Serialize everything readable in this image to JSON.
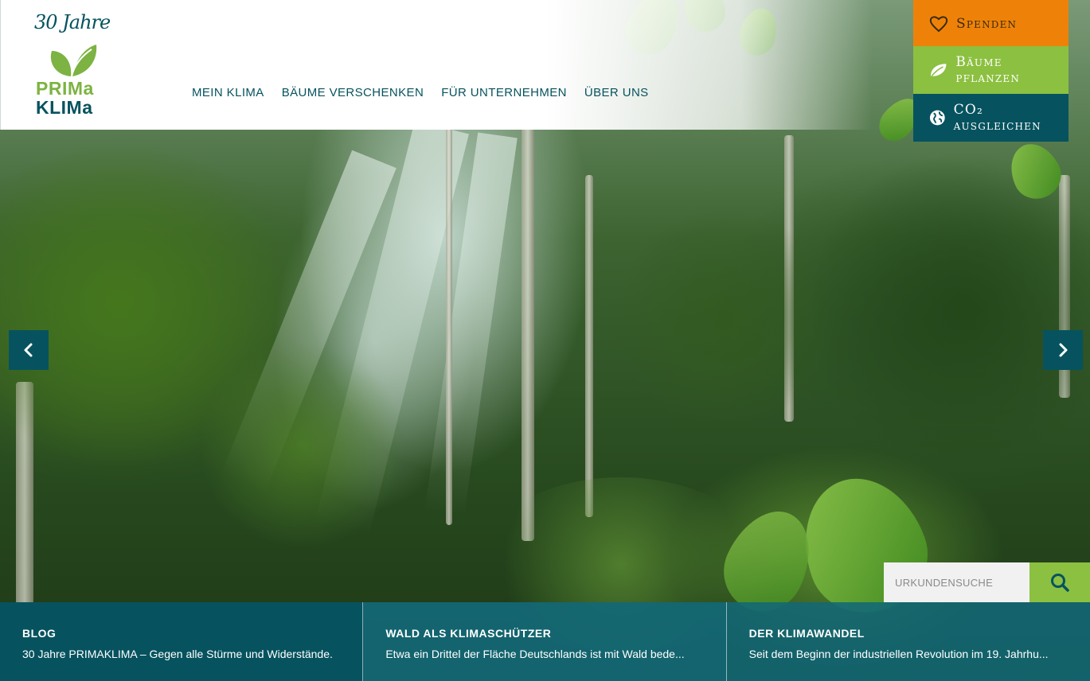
{
  "brand": {
    "anniversary": "30 Jahre",
    "wordmark_line1": "PRIMa",
    "wordmark_line2": "KLIMa",
    "colors": {
      "teal": "#06535f",
      "green": "#8cc040",
      "orange": "#ee8208"
    }
  },
  "nav": {
    "items": [
      {
        "label": "MEIN KLIMA"
      },
      {
        "label": "BÄUME VERSCHENKEN"
      },
      {
        "label": "FÜR UNTERNEHMEN"
      },
      {
        "label": "ÜBER UNS"
      }
    ]
  },
  "actions": {
    "spenden": {
      "label": "Spenden",
      "icon": "heart-icon"
    },
    "baeume": {
      "label": "Bäume pflanzen",
      "icon": "leaf-icon"
    },
    "co2": {
      "label": "CO₂ ausgleichen",
      "icon": "globe-icon"
    }
  },
  "carousel": {
    "prev_icon": "chevron-left-icon",
    "next_icon": "chevron-right-icon"
  },
  "search": {
    "placeholder": "URKUNDENSUCHE",
    "icon": "search-icon"
  },
  "teasers": [
    {
      "title": "BLOG",
      "text": "30 Jahre PRIMAKLIMA – Gegen alle Stürme und Widerstände."
    },
    {
      "title": "WALD ALS KLIMASCHÜTZER",
      "text": "Etwa ein Drittel der Fläche Deutschlands ist mit Wald bede..."
    },
    {
      "title": "DER KLIMAWANDEL",
      "text": "Seit dem Beginn der industriellen Revolution im 19. Jahrhu..."
    }
  ]
}
